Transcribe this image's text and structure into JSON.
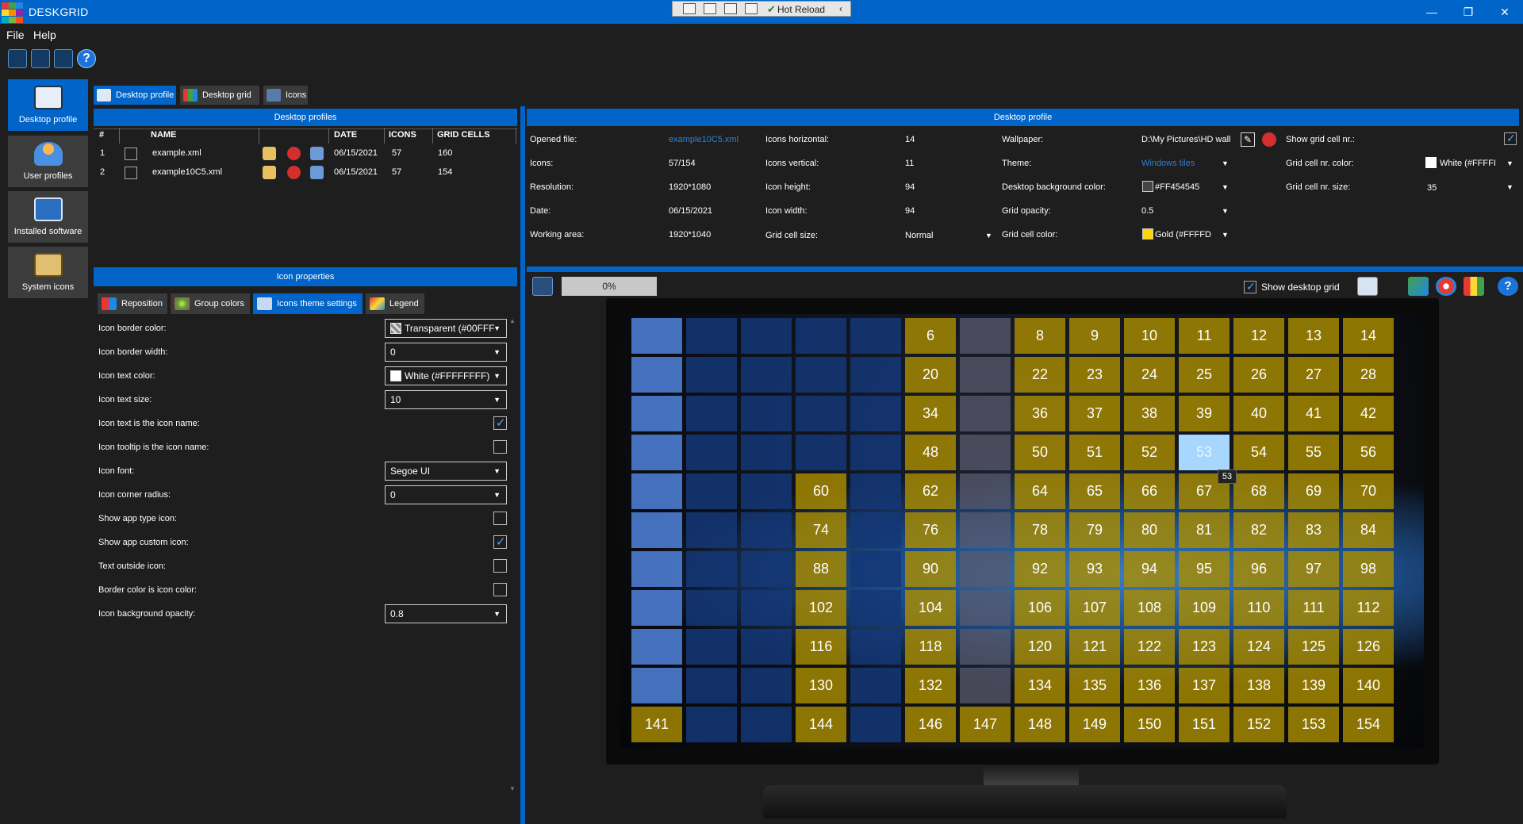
{
  "app": {
    "title": "DESKGRID",
    "hot_reload": "Hot Reload"
  },
  "menu": [
    "File",
    "Help"
  ],
  "nav": [
    {
      "label": "Desktop profile",
      "active": true
    },
    {
      "label": "User profiles"
    },
    {
      "label": "Installed software"
    },
    {
      "label": "System icons"
    }
  ],
  "tabs": [
    "Desktop profile",
    "Desktop grid",
    "Icons"
  ],
  "profiles": {
    "title": "Desktop profiles",
    "columns": [
      "#",
      "NAME",
      "DATE",
      "ICONS",
      "GRID CELLS"
    ],
    "rows": [
      {
        "num": "1",
        "name": "example.xml",
        "date": "06/15/2021",
        "icons": "57",
        "cells": "160"
      },
      {
        "num": "2",
        "name": "example10C5.xml",
        "date": "06/15/2021",
        "icons": "57",
        "cells": "154"
      }
    ]
  },
  "icon_props": {
    "title": "Icon properties",
    "subtabs": [
      "Reposition",
      "Group colors",
      "Icons theme settings",
      "Legend"
    ],
    "labels": {
      "border_color": "Icon border color:",
      "border_width": "Icon border width:",
      "text_color": "Icon text color:",
      "text_size": "Icon text size:",
      "text_is_name": "Icon text is the icon name:",
      "tooltip_is_name": "Icon tooltip is the icon name:",
      "font": "Icon font:",
      "corner": "Icon corner radius:",
      "app_type": "Show app type icon:",
      "app_custom": "Show app custom icon:",
      "text_outside": "Text outside icon:",
      "border_is_color": "Border color is icon color:",
      "bg_opacity": "Icon background opacity:"
    },
    "values": {
      "border_color": "Transparent (#00FFF",
      "border_width": "0",
      "text_color": "White (#FFFFFFFF)",
      "text_size": "10",
      "font": "Segoe UI",
      "corner": "0",
      "bg_opacity": "0.8"
    },
    "checks": {
      "text_is_name": true,
      "tooltip_is_name": false,
      "app_type": false,
      "app_custom": true,
      "text_outside": false,
      "border_is_color": false
    }
  },
  "desktop_profile": {
    "title": "Desktop profile",
    "c1": {
      "opened_file_l": "Opened file:",
      "opened_file": "example10C5.xml",
      "icons_l": "Icons:",
      "icons": "57/154",
      "res_l": "Resolution:",
      "res": "1920*1080",
      "date_l": "Date:",
      "date": "06/15/2021",
      "work_l": "Working area:",
      "work": "1920*1040"
    },
    "c2": {
      "ih_l": "Icons horizontal:",
      "ih": "14",
      "iv_l": "Icons vertical:",
      "iv": "11",
      "iht_l": "Icon height:",
      "iht": "94",
      "iw_l": "Icon width:",
      "iw": "94",
      "gcs_l": "Grid cell size:",
      "gcs": "Normal"
    },
    "c3": {
      "wall_l": "Wallpaper:",
      "wall": "D:\\My Pictures\\HD wall",
      "theme_l": "Theme:",
      "theme": "Windows tiles",
      "bg_l": "Desktop background color:",
      "bg": "#FF454545",
      "op_l": "Grid opacity:",
      "op": "0.5",
      "gc_l": "Grid cell color:",
      "gc": "Gold (#FFFFD"
    },
    "c4": {
      "show_l": "Show grid cell nr.:",
      "show": true,
      "nrc_l": "Grid cell nr. color:",
      "nrc": "White (#FFFFI",
      "nrs_l": "Grid cell nr. size:",
      "nrs": "35"
    }
  },
  "grid": {
    "progress": "0%",
    "show_grid_label": "Show desktop grid",
    "show_grid": true,
    "tooltip": "53",
    "colors": {
      "accent": "#0064c8",
      "gold": "#b08c00"
    }
  }
}
